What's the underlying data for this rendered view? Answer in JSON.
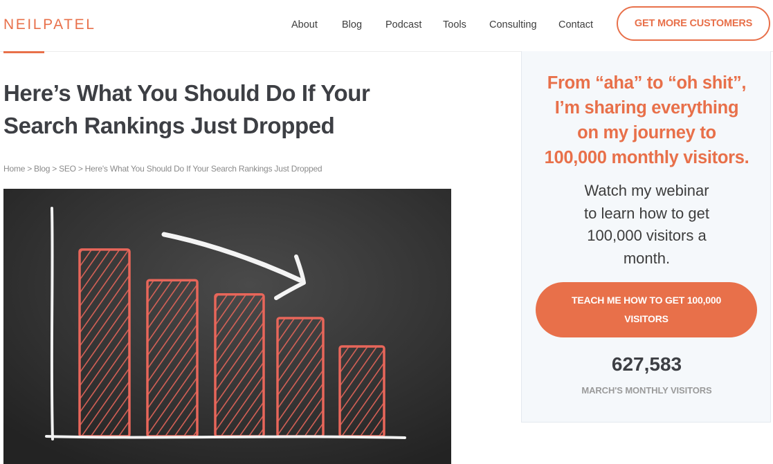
{
  "header": {
    "logo": "NEILPATEL",
    "nav": [
      "About",
      "Blog",
      "Podcast",
      "Tools",
      "Consulting",
      "Contact"
    ],
    "cta": "GET MORE CUSTOMERS"
  },
  "article": {
    "title_line1": "Here’s What You Should Do If Your",
    "title_line2": "Search Rankings Just Dropped",
    "breadcrumb": [
      "Home",
      "Blog",
      "SEO",
      "Here's What You Should Do If Your Search Rankings Just Dropped"
    ],
    "breadcrumb_separator": ">",
    "hero_image": {
      "description_icon": "declining-bar-chart-chalkboard",
      "bar_levels": [
        0.79,
        0.66,
        0.6,
        0.5,
        0.38
      ],
      "bar_color": "#e8665a",
      "background_color": "#2e2e2e"
    }
  },
  "sidebar": {
    "headline_lines": [
      "From “aha” to “oh shit”,",
      "I’m sharing everything",
      "on my journey to",
      "100,000 monthly visitors."
    ],
    "sub_lines": [
      "Watch my webinar",
      "to learn how to get",
      "100,000 visitors a",
      "month."
    ],
    "button": "TEACH ME HOW TO GET 100,000 VISITORS",
    "visitors_count": "627,583",
    "visitors_label": "MARCH'S MONTHLY VISITORS"
  },
  "colors": {
    "accent": "#e8704a",
    "text_dark": "#3d3f44",
    "sidebar_bg": "#f5f8fb"
  }
}
